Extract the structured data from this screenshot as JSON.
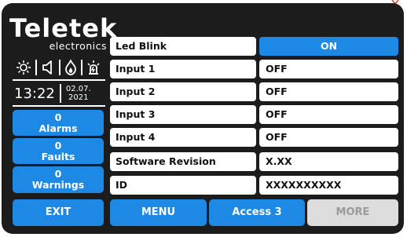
{
  "brand": {
    "name": "Teletek",
    "sub": "electronics"
  },
  "status_icons": [
    "sun-icon",
    "speaker-icon",
    "fire-icon",
    "siren-icon"
  ],
  "clock": {
    "time": "13:22",
    "date_line1": "02.07.",
    "date_line2": "2021"
  },
  "sidebar": {
    "alarms": {
      "count": "0",
      "label": "Alarms"
    },
    "faults": {
      "count": "0",
      "label": "Faults"
    },
    "warnings": {
      "count": "0",
      "label": "Warnings"
    }
  },
  "settings": [
    {
      "label": "Led Blink",
      "value": "ON"
    },
    {
      "label": "Input 1",
      "value": "OFF"
    },
    {
      "label": "Input 2",
      "value": "OFF"
    },
    {
      "label": "Input 3",
      "value": "OFF"
    },
    {
      "label": "Input 4",
      "value": "OFF"
    },
    {
      "label": "Software Revision",
      "value": "X.XX"
    },
    {
      "label": "ID",
      "value": "XXXXXXXXXX"
    }
  ],
  "bottom": {
    "exit": "EXIT",
    "menu": "MENU",
    "access": "Access 3",
    "more": "MORE"
  },
  "colors": {
    "accent": "#1e88e5",
    "panel": "#1c1c1c",
    "disabled": "#dcdcdc",
    "corner_mark": "#e53935"
  }
}
